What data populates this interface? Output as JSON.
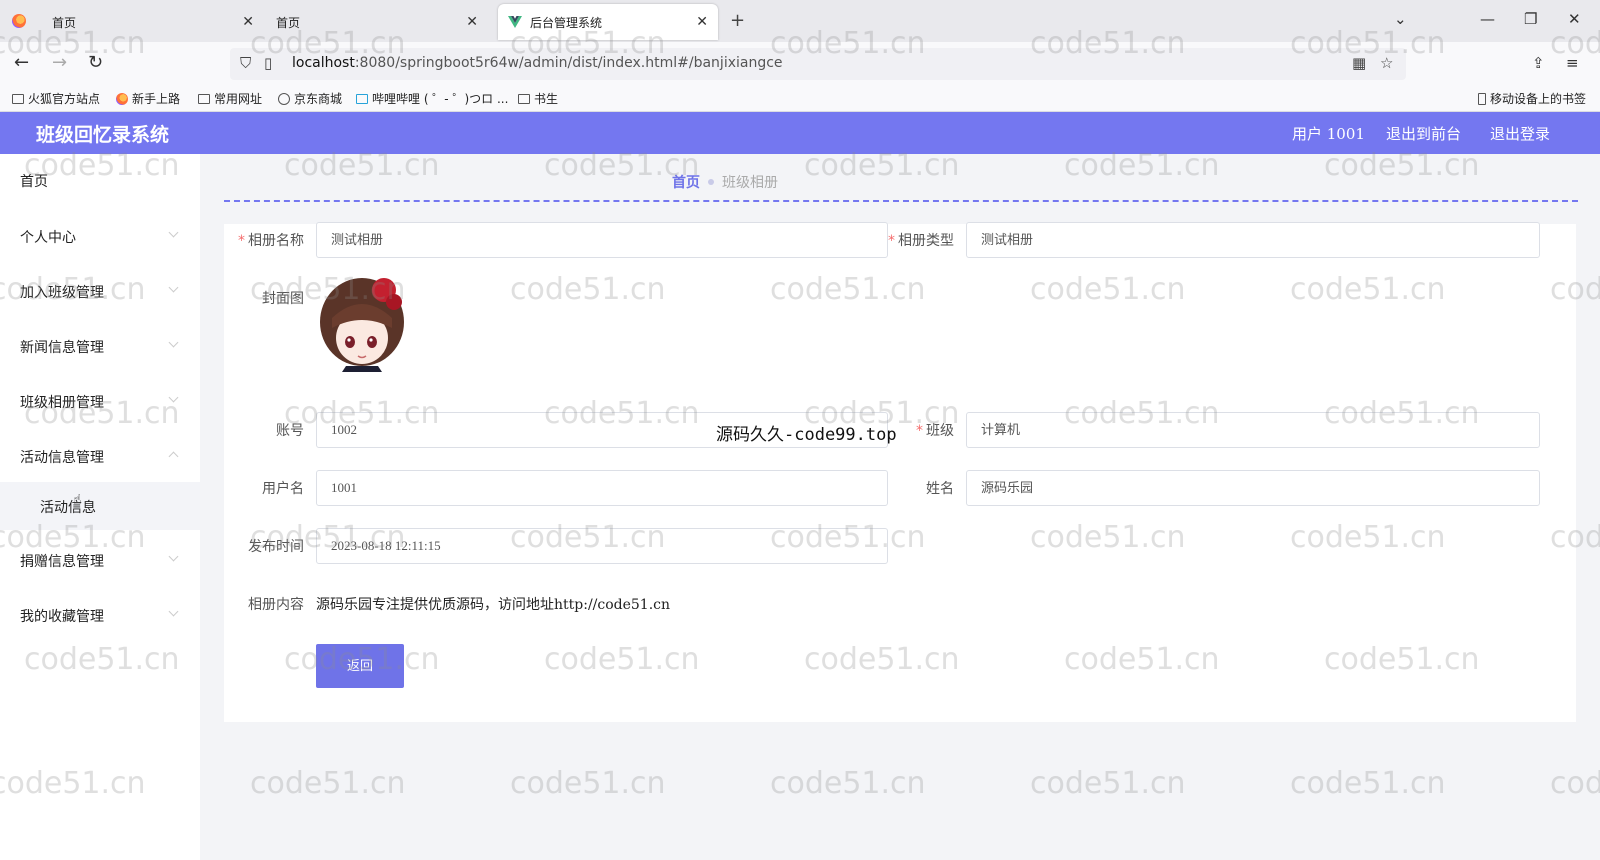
{
  "browser": {
    "tabs": [
      {
        "title": "首页"
      },
      {
        "title": "首页"
      },
      {
        "title": "后台管理系统"
      }
    ],
    "url": {
      "host": "localhost",
      "path": ":8080/springboot5r64w/admin/dist/index.html#/banjixiangce"
    },
    "bookmarks": [
      "火狐官方站点",
      "新手上路",
      "常用网址",
      "京东商城",
      "哔哩哔哩 ( ゜- ゜)つロ ...",
      "书生"
    ],
    "mobile_bookmarks": "移动设备上的书签"
  },
  "header": {
    "title": "班级回忆录系统",
    "user": "用户 1001",
    "front_link": "退出到前台",
    "logout": "退出登录",
    "accent": "#7477f0"
  },
  "sidebar": {
    "items": [
      {
        "label": "首页"
      },
      {
        "label": "个人中心"
      },
      {
        "label": "加入班级管理"
      },
      {
        "label": "新闻信息管理"
      },
      {
        "label": "班级相册管理"
      },
      {
        "label": "活动信息管理"
      },
      {
        "label": "活动信息"
      },
      {
        "label": "捐赠信息管理"
      },
      {
        "label": "我的收藏管理"
      }
    ]
  },
  "breadcrumb": {
    "home": "首页",
    "current": "班级相册"
  },
  "form": {
    "album_name": {
      "label": "相册名称",
      "value": "测试相册"
    },
    "album_type": {
      "label": "相册类型",
      "value": "测试相册"
    },
    "cover": {
      "label": "封面图"
    },
    "account": {
      "label": "账号",
      "value": "1002"
    },
    "class": {
      "label": "班级",
      "value": "计算机"
    },
    "username": {
      "label": "用户名",
      "value": "1001"
    },
    "name": {
      "label": "姓名",
      "value": "源码乐园"
    },
    "publish_time": {
      "label": "发布时间",
      "value": "2023-08-18 12:11:15"
    },
    "content": {
      "label": "相册内容",
      "value": "源码乐园专注提供优质源码，访问地址http://code51.cn"
    },
    "back_button": "返回"
  },
  "watermark": {
    "text": "code51.cn",
    "center_text": "源码久久-code99.top"
  }
}
